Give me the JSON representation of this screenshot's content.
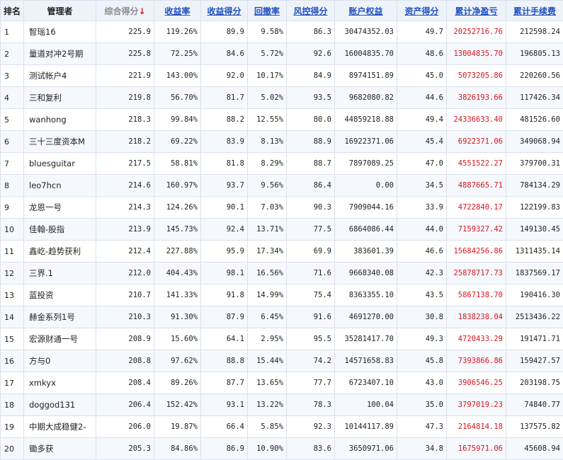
{
  "headers": {
    "rank": "排名",
    "manager": "管理者",
    "composite": "综合得分",
    "sort_arrow": "↓",
    "return_rate": "收益率",
    "return_score": "收益得分",
    "drawdown": "回撤率",
    "risk_score": "风控得分",
    "equity": "账户权益",
    "asset_score": "资产得分",
    "cum_pnl": "累计净盈亏",
    "cum_fee": "累计手续费"
  },
  "rows": [
    {
      "rank": "1",
      "name": "智瑶16",
      "composite": "225.9",
      "return_rate": "119.26%",
      "return_score": "89.9",
      "drawdown": "9.58%",
      "risk_score": "86.3",
      "equity": "30474352.03",
      "asset_score": "49.7",
      "cum_pnl": "20252716.76",
      "cum_fee": "212598.24"
    },
    {
      "rank": "2",
      "name": "量道对冲2号期",
      "composite": "225.8",
      "return_rate": "72.25%",
      "return_score": "84.6",
      "drawdown": "5.72%",
      "risk_score": "92.6",
      "equity": "16004835.70",
      "asset_score": "48.6",
      "cum_pnl": "13004835.70",
      "cum_fee": "196805.13"
    },
    {
      "rank": "3",
      "name": "测试帐户4",
      "composite": "221.9",
      "return_rate": "143.00%",
      "return_score": "92.0",
      "drawdown": "10.17%",
      "risk_score": "84.9",
      "equity": "8974151.89",
      "asset_score": "45.0",
      "cum_pnl": "5073205.86",
      "cum_fee": "220260.56"
    },
    {
      "rank": "4",
      "name": "三和复利",
      "composite": "219.8",
      "return_rate": "56.70%",
      "return_score": "81.7",
      "drawdown": "5.02%",
      "risk_score": "93.5",
      "equity": "9682080.82",
      "asset_score": "44.6",
      "cum_pnl": "3826193.66",
      "cum_fee": "117426.34"
    },
    {
      "rank": "5",
      "name": "wanhong",
      "composite": "218.3",
      "return_rate": "99.84%",
      "return_score": "88.2",
      "drawdown": "12.55%",
      "risk_score": "80.0",
      "equity": "44859218.88",
      "asset_score": "49.4",
      "cum_pnl": "24336633.40",
      "cum_fee": "481526.60"
    },
    {
      "rank": "6",
      "name": "三十三度资本M",
      "composite": "218.2",
      "return_rate": "69.22%",
      "return_score": "83.9",
      "drawdown": "8.13%",
      "risk_score": "88.9",
      "equity": "16922371.06",
      "asset_score": "45.4",
      "cum_pnl": "6922371.06",
      "cum_fee": "349068.94"
    },
    {
      "rank": "7",
      "name": "bluesguitar",
      "composite": "217.5",
      "return_rate": "58.81%",
      "return_score": "81.8",
      "drawdown": "8.29%",
      "risk_score": "88.7",
      "equity": "7897089.25",
      "asset_score": "47.0",
      "cum_pnl": "4551522.27",
      "cum_fee": "379700.31"
    },
    {
      "rank": "8",
      "name": "leo7hcn",
      "composite": "214.6",
      "return_rate": "160.97%",
      "return_score": "93.7",
      "drawdown": "9.56%",
      "risk_score": "86.4",
      "equity": "0.00",
      "asset_score": "34.5",
      "cum_pnl": "4887665.71",
      "cum_fee": "784134.29"
    },
    {
      "rank": "9",
      "name": "龙恩一号",
      "composite": "214.3",
      "return_rate": "124.26%",
      "return_score": "90.1",
      "drawdown": "7.03%",
      "risk_score": "90.3",
      "equity": "7909044.16",
      "asset_score": "33.9",
      "cum_pnl": "4722840.17",
      "cum_fee": "122199.83"
    },
    {
      "rank": "10",
      "name": "佳翰-股指",
      "composite": "213.9",
      "return_rate": "145.73%",
      "return_score": "92.4",
      "drawdown": "13.71%",
      "risk_score": "77.5",
      "equity": "6864086.44",
      "asset_score": "44.0",
      "cum_pnl": "7159327.42",
      "cum_fee": "149130.45"
    },
    {
      "rank": "11",
      "name": "鑫屹-趋势获利",
      "composite": "212.4",
      "return_rate": "227.88%",
      "return_score": "95.9",
      "drawdown": "17.34%",
      "risk_score": "69.9",
      "equity": "383601.39",
      "asset_score": "46.6",
      "cum_pnl": "15684256.86",
      "cum_fee": "1311435.14"
    },
    {
      "rank": "12",
      "name": "三界.1",
      "composite": "212.0",
      "return_rate": "404.43%",
      "return_score": "98.1",
      "drawdown": "16.56%",
      "risk_score": "71.6",
      "equity": "9668340.08",
      "asset_score": "42.3",
      "cum_pnl": "25878717.73",
      "cum_fee": "1837569.17"
    },
    {
      "rank": "13",
      "name": "蓝投资",
      "composite": "210.7",
      "return_rate": "141.33%",
      "return_score": "91.8",
      "drawdown": "14.99%",
      "risk_score": "75.4",
      "equity": "8363355.10",
      "asset_score": "43.5",
      "cum_pnl": "5867138.70",
      "cum_fee": "190416.30"
    },
    {
      "rank": "14",
      "name": "赫金系列1号",
      "composite": "210.3",
      "return_rate": "91.30%",
      "return_score": "87.9",
      "drawdown": "6.45%",
      "risk_score": "91.6",
      "equity": "4691270.00",
      "asset_score": "30.8",
      "cum_pnl": "1838238.04",
      "cum_fee": "2513436.22"
    },
    {
      "rank": "15",
      "name": "宏源财通一号",
      "composite": "208.9",
      "return_rate": "15.60%",
      "return_score": "64.1",
      "drawdown": "2.95%",
      "risk_score": "95.5",
      "equity": "35281417.70",
      "asset_score": "49.3",
      "cum_pnl": "4720433.29",
      "cum_fee": "191471.71"
    },
    {
      "rank": "16",
      "name": "方与0",
      "composite": "208.8",
      "return_rate": "97.62%",
      "return_score": "88.8",
      "drawdown": "15.44%",
      "risk_score": "74.2",
      "equity": "14571658.83",
      "asset_score": "45.8",
      "cum_pnl": "7393866.86",
      "cum_fee": "159427.57"
    },
    {
      "rank": "17",
      "name": "xmkyx",
      "composite": "208.4",
      "return_rate": "89.26%",
      "return_score": "87.7",
      "drawdown": "13.65%",
      "risk_score": "77.7",
      "equity": "6723407.10",
      "asset_score": "43.0",
      "cum_pnl": "3906546.25",
      "cum_fee": "203198.75"
    },
    {
      "rank": "18",
      "name": "doggod131",
      "composite": "206.4",
      "return_rate": "152.42%",
      "return_score": "93.1",
      "drawdown": "13.22%",
      "risk_score": "78.3",
      "equity": "100.04",
      "asset_score": "35.0",
      "cum_pnl": "3797019.23",
      "cum_fee": "74840.77"
    },
    {
      "rank": "19",
      "name": "中期大成稳健2-",
      "composite": "206.0",
      "return_rate": "19.87%",
      "return_score": "66.4",
      "drawdown": "5.85%",
      "risk_score": "92.3",
      "equity": "10144117.89",
      "asset_score": "47.3",
      "cum_pnl": "2164814.18",
      "cum_fee": "137575.82"
    },
    {
      "rank": "20",
      "name": "锄多获",
      "composite": "205.3",
      "return_rate": "84.86%",
      "return_score": "86.9",
      "drawdown": "10.90%",
      "risk_score": "83.6",
      "equity": "3650971.06",
      "asset_score": "34.8",
      "cum_pnl": "1675971.06",
      "cum_fee": "45608.94"
    }
  ]
}
